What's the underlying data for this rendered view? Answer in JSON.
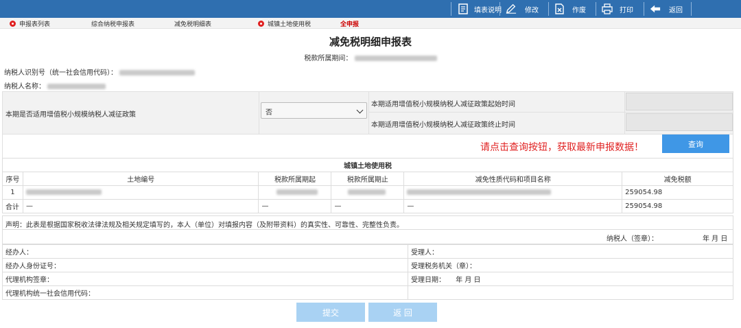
{
  "toolbar": {
    "fill_help": "填表说明",
    "modify": "修改",
    "void": "作废",
    "print": "打印",
    "back": "返回"
  },
  "tabs": [
    {
      "label": "申报表列表"
    },
    {
      "label": "综合纳税申报表"
    },
    {
      "label": "减免税明细表"
    },
    {
      "label": "城镇土地使用税"
    },
    {
      "label": "全申报"
    }
  ],
  "form": {
    "title": "减免税明细申报表",
    "period_label": "税款所属期间：",
    "taxpayer_id_label": "纳税人识别号（统一社会信用代码）：",
    "taxpayer_name_label": "纳税人名称："
  },
  "policy": {
    "question": "本期是否适用增值税小规模纳税人减征政策",
    "selected": "否",
    "start_label": "本期适用增值税小规模纳税人减征政策起始时间",
    "end_label": "本期适用增值税小规模纳税人减征政策终止时间"
  },
  "query": {
    "notice": "请点击查询按钮，获取最新申报数据！",
    "button": "查询"
  },
  "tax_table": {
    "section_title": "城镇土地使用税",
    "headers": [
      "序号",
      "土地编号",
      "税款所属期起",
      "税款所属期止",
      "减免性质代码和项目名称",
      "减免税额"
    ],
    "rows": [
      {
        "no": "1",
        "amount": "259054.98"
      }
    ],
    "total": {
      "label": "合计",
      "dash1": "—",
      "dash2": "—",
      "dash3": "—",
      "dash4": "—",
      "amount": "259054.98"
    }
  },
  "declaration": {
    "statement": "声明：此表是根据国家税收法律法规及相关规定填写的，本人（单位）对填报内容（及附带资料）的真实性、可靠性、完整性负责。",
    "sign_label": "纳税人（签章）：",
    "date_suffix": "年 月 日"
  },
  "agent": {
    "handler": "经办人：",
    "receiver": "受理人：",
    "handler_id": "经办人身份证号：",
    "tax_office": "受理税务机关（章）：",
    "agency_seal": "代理机构签章：",
    "receive_date": "受理日期：",
    "receive_date_suffix": "年 月 日",
    "agency_code": "代理机构统一社会信用代码："
  },
  "buttons": {
    "submit": "提交",
    "back": "返 回"
  },
  "colors": {
    "topbar": "#2f6fb0",
    "notice_red": "#e02222",
    "query_blue": "#3f97e6",
    "disabled_btn": "#a9d2f3"
  }
}
